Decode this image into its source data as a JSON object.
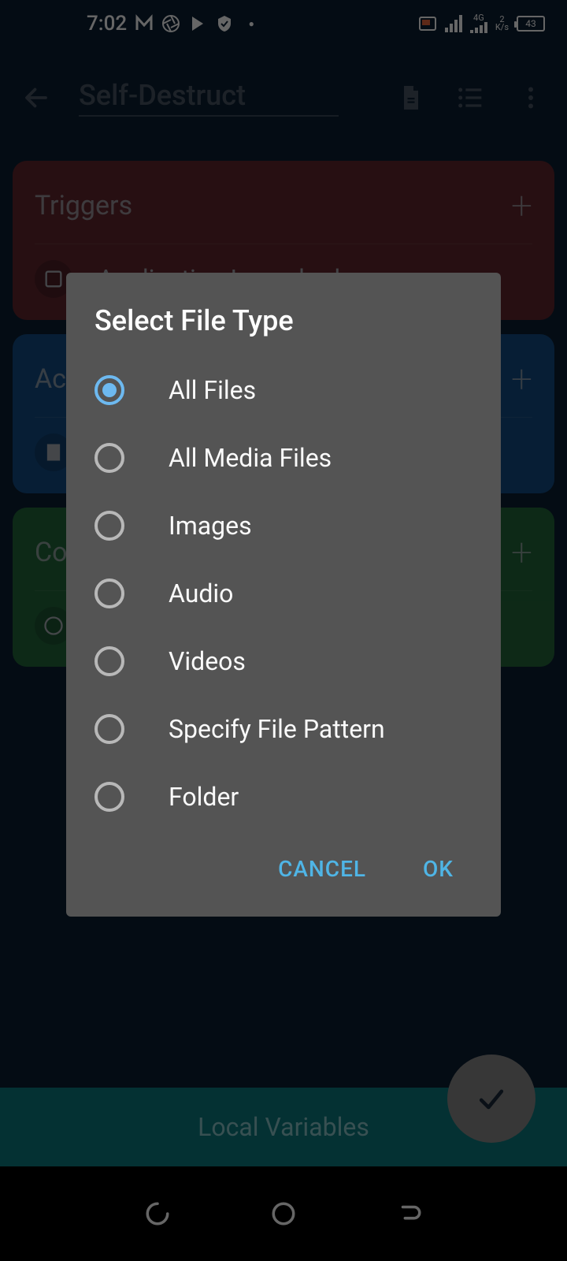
{
  "statusbar": {
    "time": "7:02",
    "network_speed": "2",
    "network_unit": "K/s",
    "network_type": "4G",
    "battery": "43"
  },
  "appbar": {
    "title": "Self-Destruct"
  },
  "cards": {
    "triggers": {
      "title": "Triggers",
      "row": "Application Launched"
    },
    "actions": {
      "title": "Ac",
      "row": ""
    },
    "constraints": {
      "title": "Co",
      "row": ""
    }
  },
  "bottombar": {
    "label": "Local Variables"
  },
  "dialog": {
    "title": "Select File Type",
    "options": [
      {
        "label": "All Files",
        "selected": true
      },
      {
        "label": "All Media Files",
        "selected": false
      },
      {
        "label": "Images",
        "selected": false
      },
      {
        "label": "Audio",
        "selected": false
      },
      {
        "label": "Videos",
        "selected": false
      },
      {
        "label": "Specify File Pattern",
        "selected": false
      },
      {
        "label": "Folder",
        "selected": false
      }
    ],
    "cancel": "CANCEL",
    "ok": "OK"
  }
}
